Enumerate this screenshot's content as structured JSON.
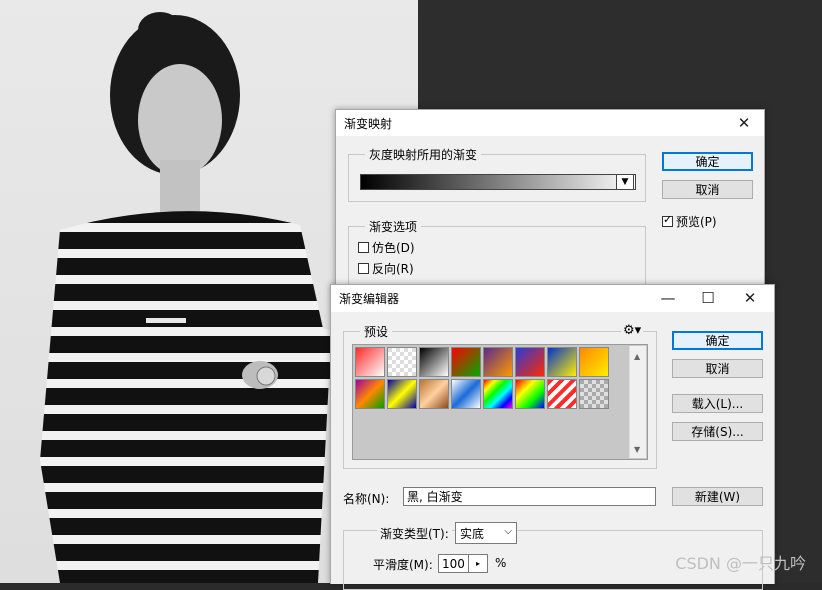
{
  "gradient_map_dialog": {
    "title": "渐变映射",
    "group_gradient_label": "灰度映射所用的渐变",
    "group_options_label": "渐变选项",
    "dither_label": "仿色(D)",
    "reverse_label": "反向(R)",
    "ok_label": "确定",
    "cancel_label": "取消",
    "preview_label": "预览(P)",
    "preview_checked": true
  },
  "gradient_editor": {
    "title": "渐变编辑器",
    "presets_label": "预设",
    "ok_label": "确定",
    "cancel_label": "取消",
    "load_label": "载入(L)...",
    "save_label": "存储(S)...",
    "name_label": "名称(N):",
    "name_value": "黑, 白渐变",
    "new_label": "新建(W)",
    "type_label": "渐变类型(T):",
    "type_value": "实底",
    "smoothness_label": "平滑度(M):",
    "smoothness_value": "100",
    "smoothness_unit": "%"
  },
  "presets_row1": [
    "linear-gradient(135deg,#ff2b2b,#fff)",
    "repeating-conic-gradient(#fff 0 25%,#ddd 0 50%) 0 0/8px 8px",
    "linear-gradient(135deg,#000,#fff)",
    "linear-gradient(135deg,#ff0000,#00aa00)",
    "linear-gradient(135deg,#5a2a8a,#ff9a00)",
    "linear-gradient(135deg,#2a3ad8,#ff2a00)",
    "linear-gradient(135deg,#0033cc,#ffee00)",
    "linear-gradient(135deg,#ff8800,#ffee00)"
  ],
  "presets_row2": [
    "linear-gradient(135deg,#a000a0,#ff8800,#00a000)",
    "linear-gradient(135deg,#0000aa,#ffff00,#0000aa)",
    "linear-gradient(135deg,#b87333,#ffd0a0,#8a4a20)",
    "linear-gradient(135deg,#ffffff,#1b6bd8,#ffffff)",
    "linear-gradient(135deg,#ff0000,#ffff00,#00ff00,#00ffff,#0000ff,#ff00ff)",
    "linear-gradient(135deg,#ff0000,#ffff00,#00ff00,#0000ff)",
    "repeating-linear-gradient(135deg,#ff2a2a 0 4px,#fff 4px 8px)",
    "repeating-conic-gradient(#e0e0e0 0 25%,#aaa 0 50%) 0 0/8px 8px"
  ],
  "watermark": "CSDN @一只九吟"
}
